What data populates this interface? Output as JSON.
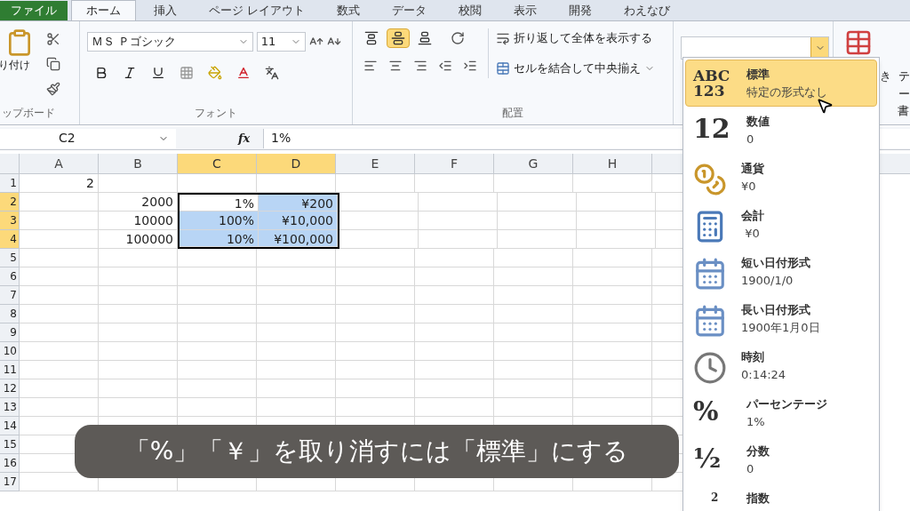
{
  "ribbon_tabs": [
    {
      "label": "ファイル",
      "kind": "file",
      "selected": false
    },
    {
      "label": "ホーム",
      "kind": "tab",
      "selected": true
    },
    {
      "label": "挿入",
      "kind": "tab",
      "selected": false
    },
    {
      "label": "ページ レイアウト",
      "kind": "tab",
      "selected": false
    },
    {
      "label": "数式",
      "kind": "tab",
      "selected": false
    },
    {
      "label": "データ",
      "kind": "tab",
      "selected": false
    },
    {
      "label": "校閲",
      "kind": "tab",
      "selected": false
    },
    {
      "label": "表示",
      "kind": "tab",
      "selected": false
    },
    {
      "label": "開発",
      "kind": "tab",
      "selected": false
    },
    {
      "label": "わえなび",
      "kind": "tab",
      "selected": false
    }
  ],
  "clipboard": {
    "paste_label": "り付け",
    "group_label": "ップボード"
  },
  "font_group": {
    "font_name": "ＭＳ Ｐゴシック",
    "font_size": "11",
    "group_label": "フォント"
  },
  "alignment_group": {
    "vertical_align": [
      {
        "selected": false
      },
      {
        "selected": true
      },
      {
        "selected": false
      }
    ],
    "wrap_text": "折り返して全体を表示する",
    "merge_center": "セルを結合して中央揃え",
    "group_label": "配置"
  },
  "styles_group": {
    "texts": [
      "き",
      "テー",
      "書"
    ]
  },
  "formula_bar": {
    "name_box": "C2",
    "function_label": "fx",
    "formula": "1%"
  },
  "sheet": {
    "columns": [
      {
        "label": "A",
        "selected": false
      },
      {
        "label": "B",
        "selected": false
      },
      {
        "label": "C",
        "selected": true
      },
      {
        "label": "D",
        "selected": true
      },
      {
        "label": "E",
        "selected": false
      },
      {
        "label": "F",
        "selected": false
      },
      {
        "label": "G",
        "selected": false
      },
      {
        "label": "H",
        "selected": false
      }
    ],
    "rows": [
      {
        "label": "1",
        "selected": false,
        "cells": [
          {
            "value": "2",
            "selected": false
          },
          {
            "selected": false
          },
          {
            "selected": false
          },
          {
            "selected": false
          }
        ]
      },
      {
        "label": "2",
        "selected": true,
        "cells": [
          {
            "selected": false
          },
          {
            "value": "2000",
            "selected": false
          },
          {
            "value": "1%",
            "selected": true,
            "active": true
          },
          {
            "value": "¥200",
            "selected": true,
            "active": false
          }
        ]
      },
      {
        "label": "3",
        "selected": true,
        "cells": [
          {
            "selected": false
          },
          {
            "value": "10000",
            "selected": false
          },
          {
            "value": "100%",
            "selected": true,
            "active": false
          },
          {
            "value": "¥10,000",
            "selected": true,
            "active": false
          }
        ]
      },
      {
        "label": "4",
        "selected": true,
        "cells": [
          {
            "selected": false
          },
          {
            "value": "100000",
            "selected": false
          },
          {
            "value": "10%",
            "selected": true,
            "active": false
          },
          {
            "value": "¥100,000",
            "selected": true,
            "active": false
          }
        ]
      },
      {
        "label": "5",
        "selected": false
      },
      {
        "label": "6",
        "selected": false
      },
      {
        "label": "7",
        "selected": false
      },
      {
        "label": "8",
        "selected": false
      },
      {
        "label": "9",
        "selected": false
      },
      {
        "label": "10",
        "selected": false
      },
      {
        "label": "11",
        "selected": false
      },
      {
        "label": "12",
        "selected": false
      },
      {
        "label": "13",
        "selected": false
      },
      {
        "label": "14",
        "selected": false
      },
      {
        "label": "15",
        "selected": false
      },
      {
        "label": "16",
        "selected": false
      },
      {
        "label": "17",
        "selected": false
      }
    ]
  },
  "number_format_menu": [
    {
      "kind": "abc",
      "icon_text": [
        "ABC",
        "123"
      ],
      "title": "標準",
      "example": "特定の形式なし",
      "selected": true
    },
    {
      "kind": "big",
      "icon_text": [
        "12"
      ],
      "title": "数値",
      "example": "0",
      "selected": false
    },
    {
      "kind": "currency",
      "title": "通貨",
      "example": "¥0",
      "selected": false
    },
    {
      "kind": "accounting",
      "title": "会計",
      "example": " ¥0",
      "selected": false
    },
    {
      "kind": "short_date",
      "title": "短い日付形式",
      "example": "1900/1/0",
      "selected": false
    },
    {
      "kind": "long_date",
      "title": "長い日付形式",
      "example": "1900年1月0日",
      "selected": false
    },
    {
      "kind": "clock",
      "title": "時刻",
      "example": "0:14:24",
      "selected": false
    },
    {
      "kind": "big",
      "icon_text": [
        "%"
      ],
      "title": "パーセンテージ",
      "example": "1%",
      "selected": false
    },
    {
      "kind": "big",
      "icon_text": [
        "½"
      ],
      "title": "分数",
      "example": "0",
      "selected": false
    },
    {
      "kind": "small",
      "icon_text": [
        "2"
      ],
      "title": "指数",
      "selected": false
    }
  ],
  "caption": "「%」「￥」を取り消すには「標準」にする"
}
